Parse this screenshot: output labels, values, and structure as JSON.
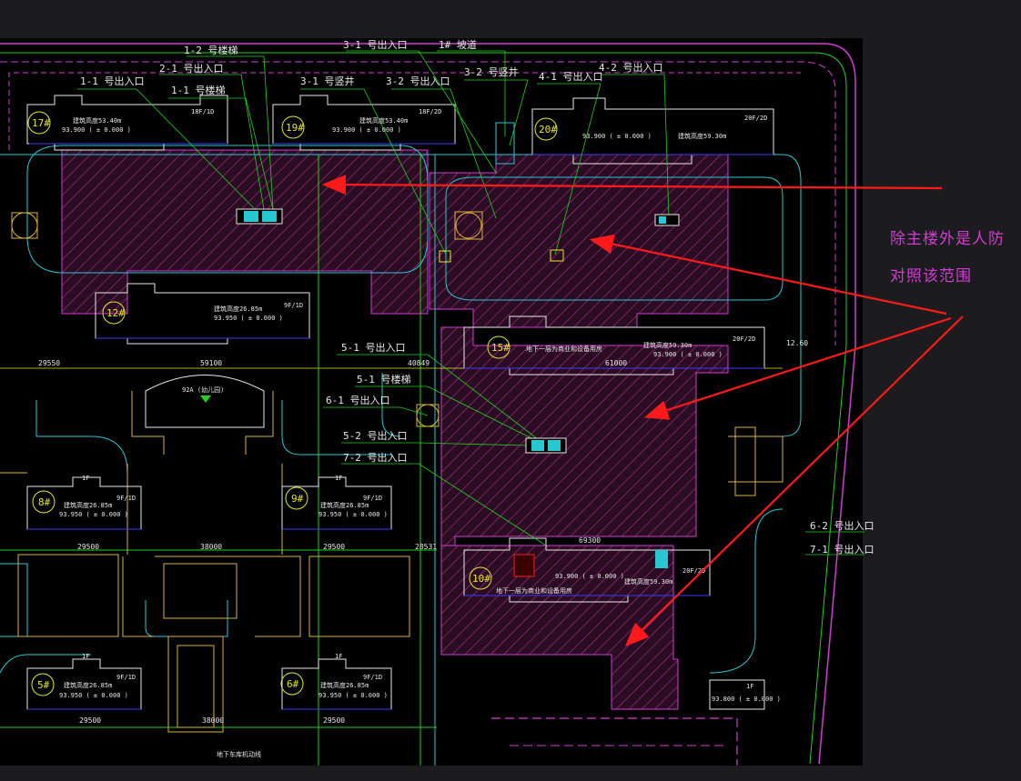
{
  "colors": {
    "background": "#1c1c1e",
    "drawing_bg": "#000000",
    "hatch": "#9a2a7a",
    "magenta": "#d23cd2",
    "green": "#1fd21f",
    "cyan": "#27c8d0",
    "yellow": "#e6e62a",
    "white": "#e8e8e8",
    "red": "#ff1a1a",
    "blue": "#3c3cff",
    "orange": "#d89a3a"
  },
  "annotation": {
    "line1": "除主楼外是人防",
    "line2": "对照该范围"
  },
  "top_labels": {
    "l1_2_stair": "1-2  号楼梯",
    "l2_1_exit": "2-1  号出入口",
    "l1_1_exit": "1-1  号出入口",
    "l1_1_stair": "1-1  号楼梯",
    "l3_1_exit_top": "3-1  号出入口",
    "l1_ramp": "1# 坡道",
    "l3_1_shaft": "3-1  号竖井",
    "l3_2_exit": "3-2  号出入口",
    "l3_2_shaft": "3-2  号竖井",
    "l4_1_exit": "4-1  号出入口",
    "l4_2_exit": "4-2  号出入口"
  },
  "mid_labels": {
    "l5_1_exit": "5-1  号出入口",
    "l5_1_stair": "5-1  号楼梯",
    "l6_1_exit": "6-1  号出入口",
    "l5_2_exit": "5-2  号出入口",
    "l7_2_exit": "7-2  号出入口",
    "l6_2_exit": "6-2  号出入口",
    "l7_1_exit": "7-1  号出入口"
  },
  "buildings": {
    "b17": "17#",
    "b19": "19#",
    "b20": "20#",
    "b12": "12#",
    "b15": "15#",
    "b8": "8#",
    "b9": "9#",
    "b10": "10#",
    "b5": "5#",
    "b6": "6#"
  },
  "building_texts": {
    "floors_18f": "18F/1D",
    "floors_18f2d": "18F/2D",
    "floors_20f": "20F/2D",
    "floors_9f": "9F/1D",
    "floors_1f": "1F",
    "height_53": "建筑高度53.40m",
    "height_59": "建筑高度59.30m",
    "height_26": "建筑高度26.85m",
    "elev_93900": "93.900  ( ± 0.000 )",
    "elev_93950": "93.950  ( ± 0.000 )",
    "elev_93800": "93.800  ( ± 0.000 )",
    "school": "92A (幼儿园)",
    "basement": "地下一层为商业和设备用房",
    "basement2": "地下车库机动线"
  },
  "dimensions": {
    "d29550": "29550",
    "d59100": "59100",
    "d40849": "40849",
    "d61000": "61000",
    "d29500a": "29500",
    "d38000": "38000",
    "d29500b": "29500",
    "d28531": "28531",
    "d69300": "69300",
    "d29500c": "29500",
    "d38000b": "38000",
    "d29500d": "29500",
    "d1260": "12.60"
  }
}
